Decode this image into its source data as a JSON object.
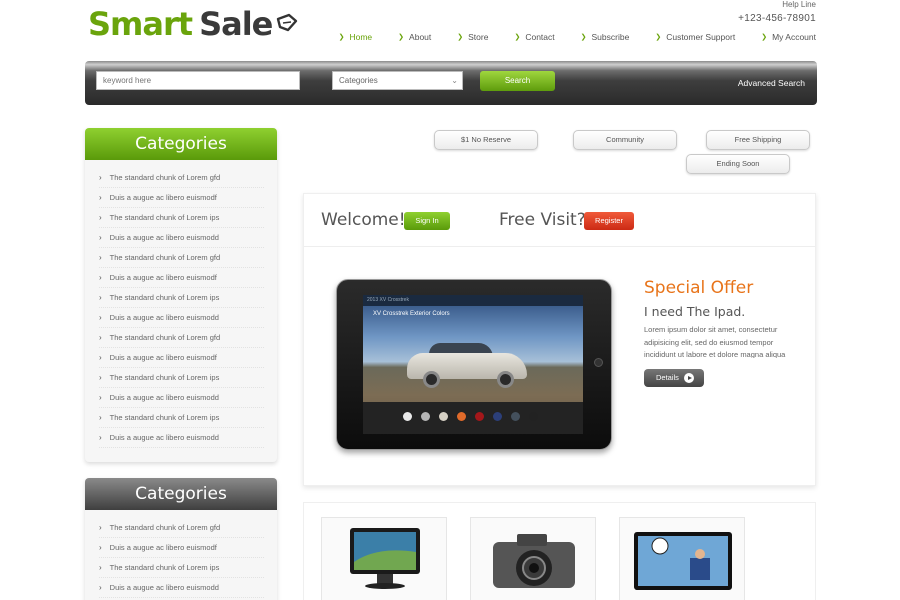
{
  "brand": {
    "name_part1": "Smart",
    "name_part2": "Sale",
    "icon": "tag-icon",
    "color_primary": "#6aa40c"
  },
  "header": {
    "helpline_label": "Help Line",
    "phone": "+123-456-78901"
  },
  "nav": {
    "items": [
      {
        "label": "Home",
        "active": true
      },
      {
        "label": "About"
      },
      {
        "label": "Store"
      },
      {
        "label": "Contact"
      },
      {
        "label": "Subscribe"
      },
      {
        "label": "Customer Support"
      },
      {
        "label": "My Account"
      }
    ]
  },
  "search": {
    "placeholder": "keyword here",
    "category_selected": "Categories",
    "button_label": "Search",
    "advanced_label": "Advanced Search"
  },
  "sidebar": {
    "box1": {
      "title": "Categories",
      "items": [
        "The standard chunk of Lorem gfd",
        "Duis a augue ac libero euismodf",
        "The standard chunk of Lorem ips",
        "Duis a augue ac libero euismodd",
        "The standard chunk of Lorem gfd",
        "Duis a augue ac libero euismodf",
        "The standard chunk of Lorem ips",
        "Duis a augue ac libero euismodd",
        "The standard chunk of Lorem gfd",
        "Duis a augue ac libero euismodf",
        "The standard chunk of Lorem ips",
        "Duis a augue ac libero euismodd",
        "The standard chunk of Lorem ips",
        "Duis a augue ac libero euismodd"
      ]
    },
    "box2": {
      "title": "Categories",
      "items": [
        "The standard chunk of Lorem gfd",
        "Duis a augue ac libero euismodf",
        "The standard chunk of Lorem ips",
        "Duis a augue ac libero euismodd"
      ]
    }
  },
  "tags": [
    "$1 No Reserve",
    "Community",
    "Free Shipping",
    "Ending Soon"
  ],
  "welcome": {
    "welcome_label": "Welcome!",
    "signin_label": "Sign In",
    "freevisit_label": "Free Visit?",
    "register_label": "Register"
  },
  "screen": {
    "top_text": "2013 XV Crosstrek",
    "title": "XV Crosstrek Exterior Colors",
    "swatch_colors": [
      "#e9e9e9",
      "#b5b5b5",
      "#d6d0c4",
      "#e06a2a",
      "#a4171a",
      "#2c3f79",
      "#44505c",
      "#222222"
    ]
  },
  "offer": {
    "title": "Special Offer",
    "subtitle": "I need The Ipad.",
    "description": "Lorem ipsum dolor sit amet, consectetur adipisicing elit, sed do eiusmod tempor incididunt ut labore et dolore magna aliqua",
    "details_label": "Details"
  },
  "products": [
    "monitor-icon",
    "camera-icon",
    "tv-icon"
  ]
}
